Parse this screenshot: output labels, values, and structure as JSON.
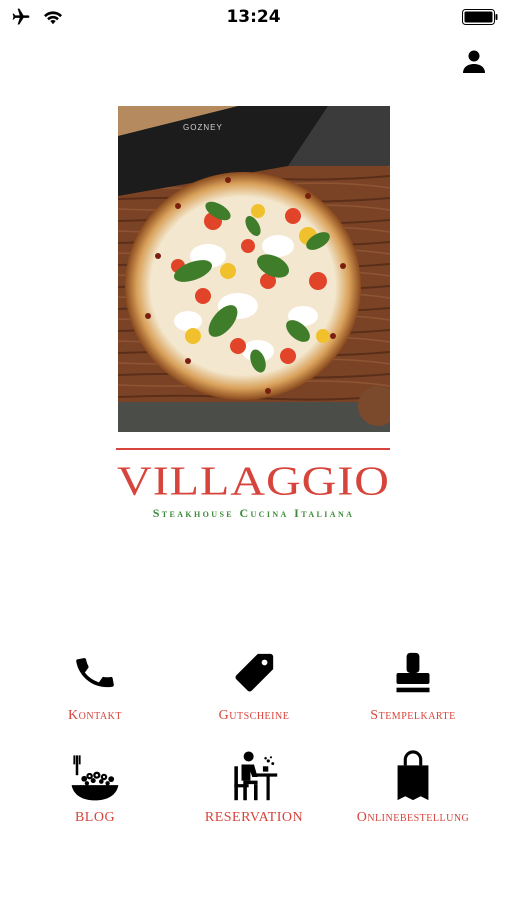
{
  "status": {
    "time": "13:24",
    "icons": [
      "airplane-icon",
      "wifi-icon",
      "battery-icon"
    ]
  },
  "header": {
    "profile_icon": "user-icon"
  },
  "hero": {
    "image": "pizza-photo",
    "oven_label": "GOZNEY"
  },
  "brand": {
    "title": "VILLAGGIO",
    "subtitle": "Steakhouse Cucina Italiana",
    "accent_color": "#d7443b",
    "subtitle_color": "#3d8a3a"
  },
  "menu": {
    "items": [
      {
        "label": "Kontakt",
        "icon": "phone-icon"
      },
      {
        "label": "Gutscheine",
        "icon": "tag-icon"
      },
      {
        "label": "Stempelkarte",
        "icon": "stamp-icon"
      },
      {
        "label": "BLOG",
        "icon": "salad-bowl-icon"
      },
      {
        "label": "RESERVATION",
        "icon": "diner-icon"
      },
      {
        "label": "Onlinebestellung",
        "icon": "shopping-bag-icon"
      }
    ]
  }
}
